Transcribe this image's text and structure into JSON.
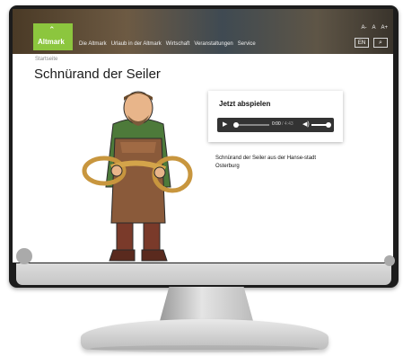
{
  "header": {
    "logo_text": "Altmark",
    "nav": [
      "Die Altmark",
      "Urlaub in der Altmark",
      "Wirtschaft",
      "Veranstaltungen",
      "Service"
    ],
    "font_sizes": [
      "A-",
      "A",
      "A+"
    ],
    "lang_button": "EN",
    "search_icon": "search-icon"
  },
  "breadcrumb": "Startseite",
  "page": {
    "title": "Schnürand der Seiler"
  },
  "audio": {
    "heading": "Jetzt abspielen",
    "current_time": "0:00",
    "duration": "/ 4:43"
  },
  "description": "Schnürand der Seiler aus der Hanse-stadt Osterburg",
  "colors": {
    "logo_green": "#8cc63e"
  }
}
